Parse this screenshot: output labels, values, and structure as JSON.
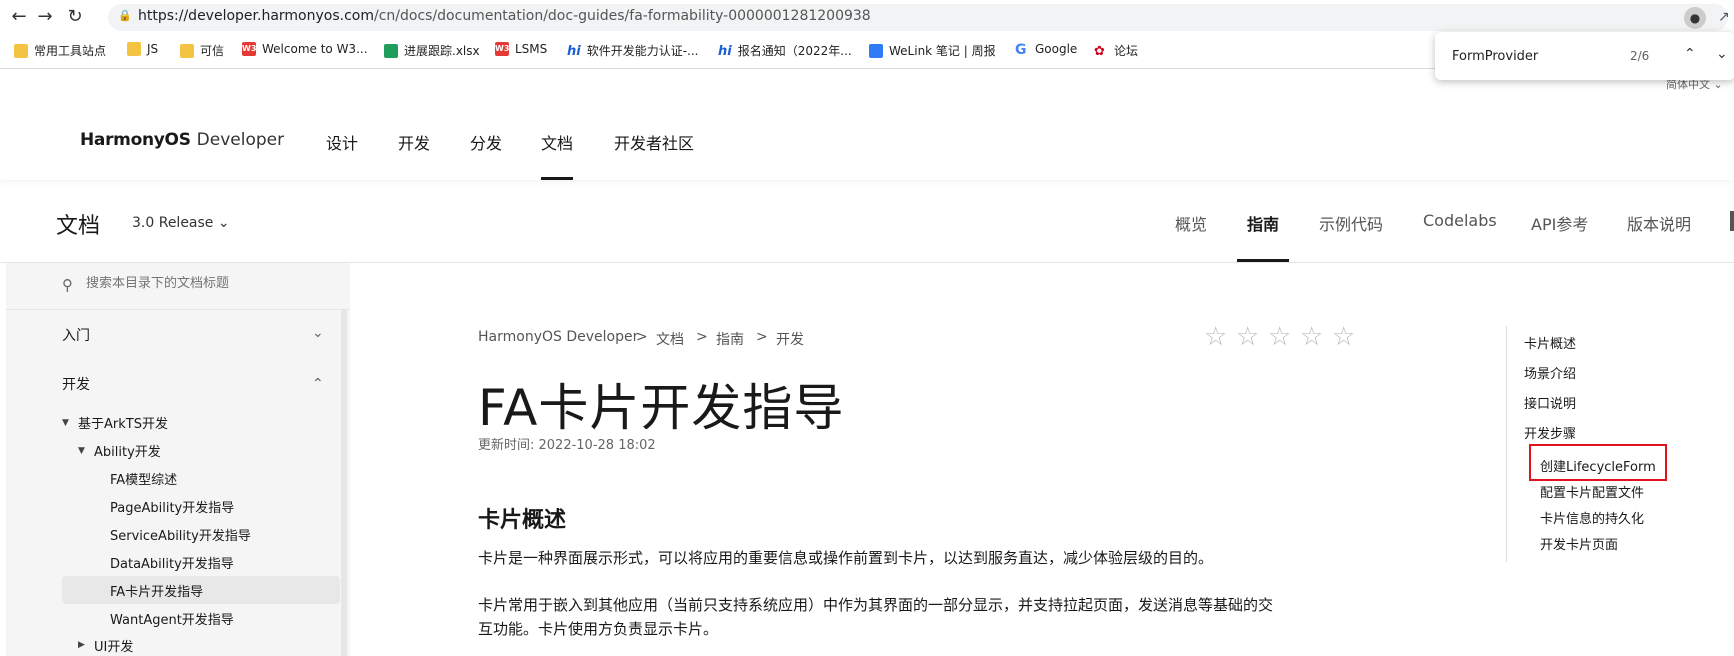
{
  "browser": {
    "url_host": "https://developer.harmonyos.com",
    "url_path": "/cn/docs/documentation/doc-guides/fa-formability-0000001281200938",
    "bookmarks": [
      "常用工具站点",
      "JS",
      "可信",
      "Welcome to W3...",
      "进展跟踪.xlsx",
      "LSMS",
      "软件开发能力认证-...",
      "报名通知（2022年...",
      "WeLink 笔记 | 周报",
      "Google",
      "论坛"
    ],
    "find": {
      "query": "FormProvider",
      "count": "2/6"
    },
    "language": "简体中文"
  },
  "header": {
    "logo_brand": "HarmonyOS",
    "logo_suffix": "Developer",
    "nav": [
      "设计",
      "开发",
      "分发",
      "文档",
      "开发者社区"
    ]
  },
  "subheader": {
    "title": "文档",
    "version": "3.0 Release",
    "tabs": [
      "概览",
      "指南",
      "示例代码",
      "Codelabs",
      "API参考",
      "版本说明"
    ]
  },
  "sidebar": {
    "search_placeholder": "搜索本目录下的文档标题",
    "sections": [
      "入门",
      "开发"
    ],
    "items": [
      "基于ArkTS开发",
      "Ability开发",
      "FA模型综述",
      "PageAbility开发指导",
      "ServiceAbility开发指导",
      "DataAbility开发指导",
      "FA卡片开发指导",
      "WantAgent开发指导",
      "UI开发"
    ]
  },
  "main": {
    "breadcrumb": [
      "HarmonyOS Developer",
      "文档",
      "指南",
      "开发"
    ],
    "title": "FA卡片开发指导",
    "updated": "更新时间: 2022-10-28 18:02",
    "section_title": "卡片概述",
    "para1": "卡片是一种界面展示形式，可以将应用的重要信息或操作前置到卡片，以达到服务直达，减少体验层级的目的。",
    "para2": "卡片常用于嵌入到其他应用（当前只支持系统应用）中作为其界面的一部分显示，并支持拉起页面，发送消息等基础的交互功能。卡片使用方负责显示卡片。",
    "rating_stars": 0
  },
  "toc": [
    "卡片概述",
    "场景介绍",
    "接口说明",
    "开发步骤",
    "创建LifecycleForm",
    "配置卡片配置文件",
    "卡片信息的持久化",
    "开发卡片页面"
  ]
}
